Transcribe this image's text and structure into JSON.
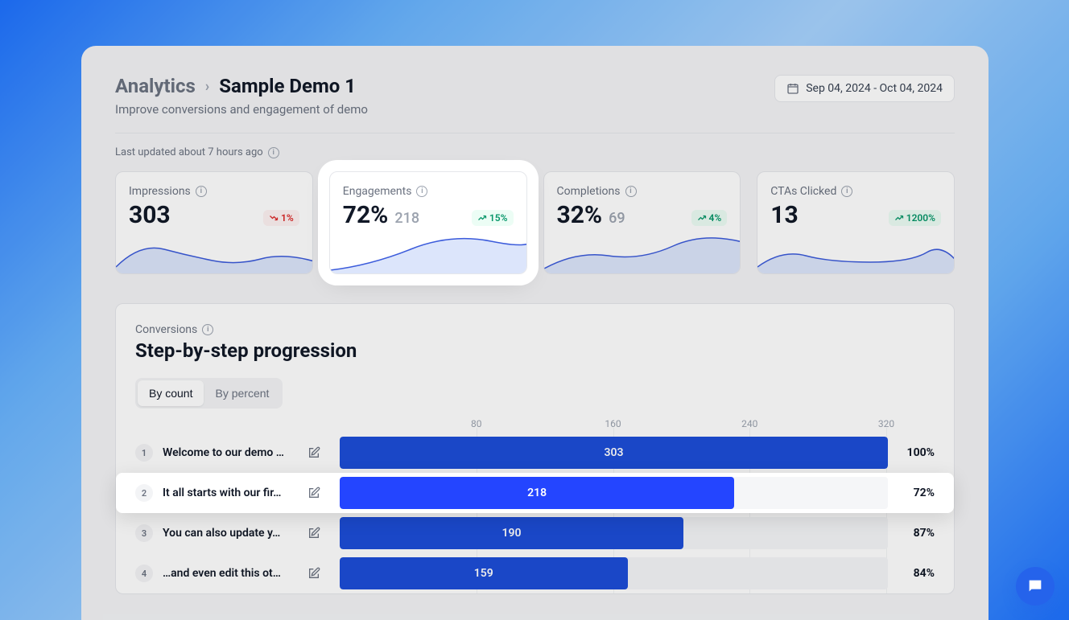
{
  "breadcrumb": {
    "parent": "Analytics",
    "current": "Sample Demo 1"
  },
  "subtitle": "Improve conversions and engagement of demo",
  "date_range": "Sep 04, 2024 - Oct 04, 2024",
  "last_updated": "Last updated about 7 hours ago",
  "cards": [
    {
      "title": "Impressions",
      "value": "303",
      "secondary": "",
      "delta": "1%",
      "dir": "down"
    },
    {
      "title": "Engagements",
      "value": "72%",
      "secondary": "218",
      "delta": "15%",
      "dir": "up"
    },
    {
      "title": "Completions",
      "value": "32%",
      "secondary": "69",
      "delta": "4%",
      "dir": "up"
    },
    {
      "title": "CTAs Clicked",
      "value": "13",
      "secondary": "",
      "delta": "1200%",
      "dir": "up"
    }
  ],
  "conversions": {
    "label": "Conversions",
    "title": "Step-by-step progression",
    "tabs": [
      "By count",
      "By percent"
    ],
    "active_tab": 0,
    "axis": [
      "80",
      "160",
      "240",
      "320"
    ],
    "steps": [
      {
        "n": "1",
        "label": "Welcome to our demo …",
        "count": "303",
        "pct": "100%",
        "w": 100
      },
      {
        "n": "2",
        "label": "It all starts with our fir…",
        "count": "218",
        "pct": "72%",
        "w": 72
      },
      {
        "n": "3",
        "label": "You can also update y…",
        "count": "190",
        "pct": "87%",
        "w": 62.7
      },
      {
        "n": "4",
        "label": "…and even edit this ot…",
        "count": "159",
        "pct": "84%",
        "w": 52.5
      }
    ]
  },
  "chart_data": {
    "type": "bar",
    "title": "Step-by-step progression",
    "xlabel": "",
    "ylabel": "",
    "categories": [
      "Welcome to our demo …",
      "It all starts with our fir…",
      "You can also update y…",
      "…and even edit this ot…"
    ],
    "values": [
      303,
      218,
      190,
      159
    ],
    "percent": [
      100,
      72,
      87,
      84
    ],
    "xlim": [
      0,
      320
    ]
  }
}
